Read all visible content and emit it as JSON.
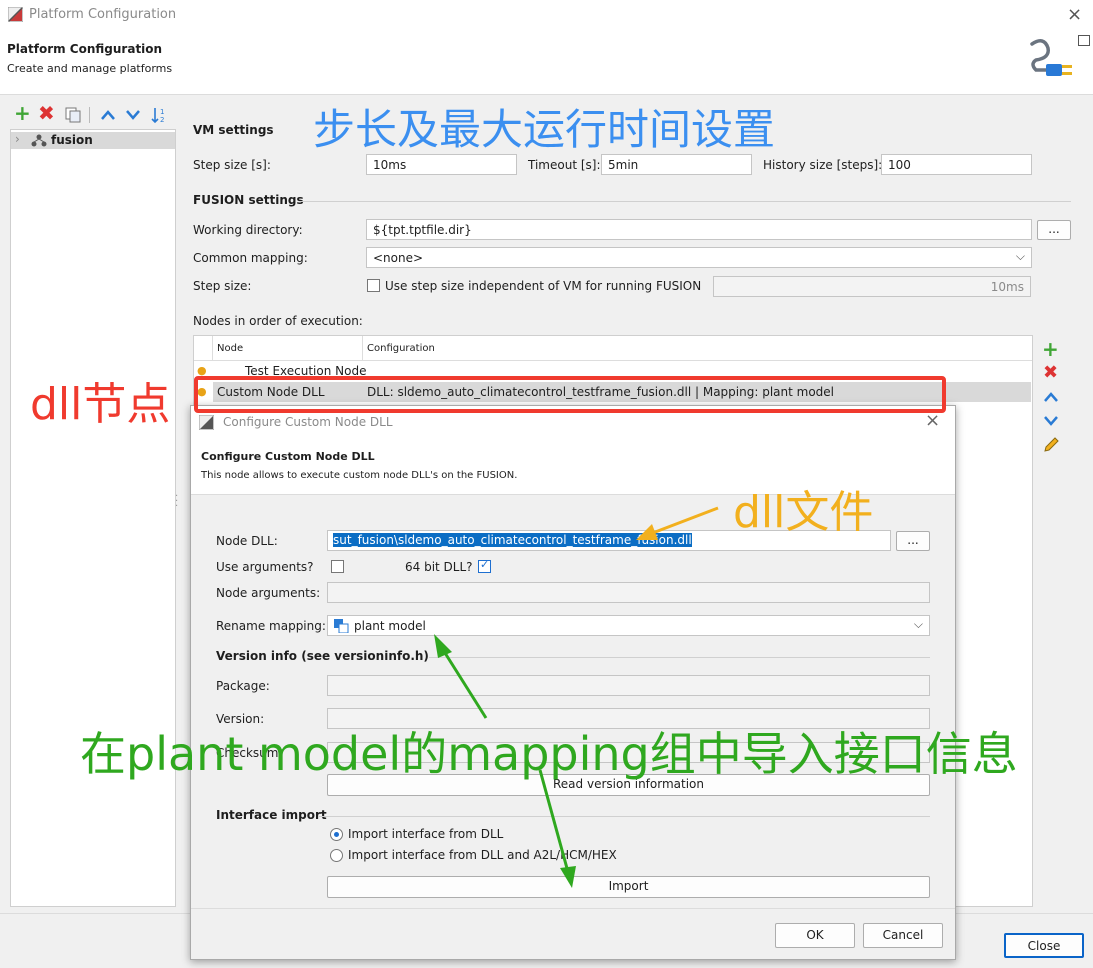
{
  "window": {
    "title": "Platform Configuration"
  },
  "header": {
    "title": "Platform Configuration",
    "subtitle": "Create and manage platforms"
  },
  "tree": {
    "items": [
      {
        "label": "fusion"
      }
    ]
  },
  "vm": {
    "section": "VM settings",
    "step_label": "Step size [s]:",
    "step_value": "10ms",
    "timeout_label": "Timeout [s]:",
    "timeout_value": "5min",
    "history_label": "History size [steps]:",
    "history_value": "100"
  },
  "fusion": {
    "section": "FUSION settings",
    "workdir_label": "Working directory:",
    "workdir_value": "${tpt.tptfile.dir}",
    "browse_label": "...",
    "mapping_label": "Common mapping:",
    "mapping_value": "<none>",
    "stepsize_label": "Step size:",
    "stepsize_check_label": "Use step size independent of VM for running FUSION",
    "stepsize_value": "10ms"
  },
  "nodes": {
    "label": "Nodes in order of execution:",
    "columns": [
      "Node",
      "Configuration"
    ],
    "rows": [
      {
        "node": "Test Execution Node",
        "config": ""
      },
      {
        "node": "Custom Node DLL",
        "config": "DLL: sldemo_auto_climatecontrol_testframe_fusion.dll | Mapping: plant model"
      }
    ]
  },
  "dialog": {
    "title": "Configure Custom Node DLL",
    "heading": "Configure Custom Node DLL",
    "description": "This node allows to execute custom node DLL's on the FUSION.",
    "dll_label": "Node DLL:",
    "dll_value": "sut_fusion\\sldemo_auto_climatecontrol_testframe_fusion.dll",
    "browse_label": "...",
    "use_args_label": "Use arguments?",
    "bit64_label": "64 bit DLL?",
    "args_label": "Node arguments:",
    "rename_label": "Rename mapping:",
    "rename_value": "plant model",
    "version_section": "Version info (see versioninfo.h)",
    "package_label": "Package:",
    "version_label": "Version:",
    "checksum_label": "Checksum:",
    "read_version_button": "Read version information",
    "interface_section": "Interface import",
    "radio1": "Import interface from DLL",
    "radio2": "Import interface from DLL and A2L/HCM/HEX",
    "import_button": "Import",
    "ok_button": "OK",
    "cancel_button": "Cancel"
  },
  "footer": {
    "close_button": "Close"
  },
  "annotations": {
    "blue": "步长及最大运行时间设置",
    "red": "dll节点",
    "yellow": "dll文件",
    "green": "在plant model的mapping组中导入接口信息"
  },
  "colors": {
    "accent_blue": "#3b8ff0",
    "annot_red": "#f03a2e",
    "annot_yellow": "#f2b01e",
    "annot_green": "#2fa81f",
    "selection": "#0b6dc4"
  }
}
